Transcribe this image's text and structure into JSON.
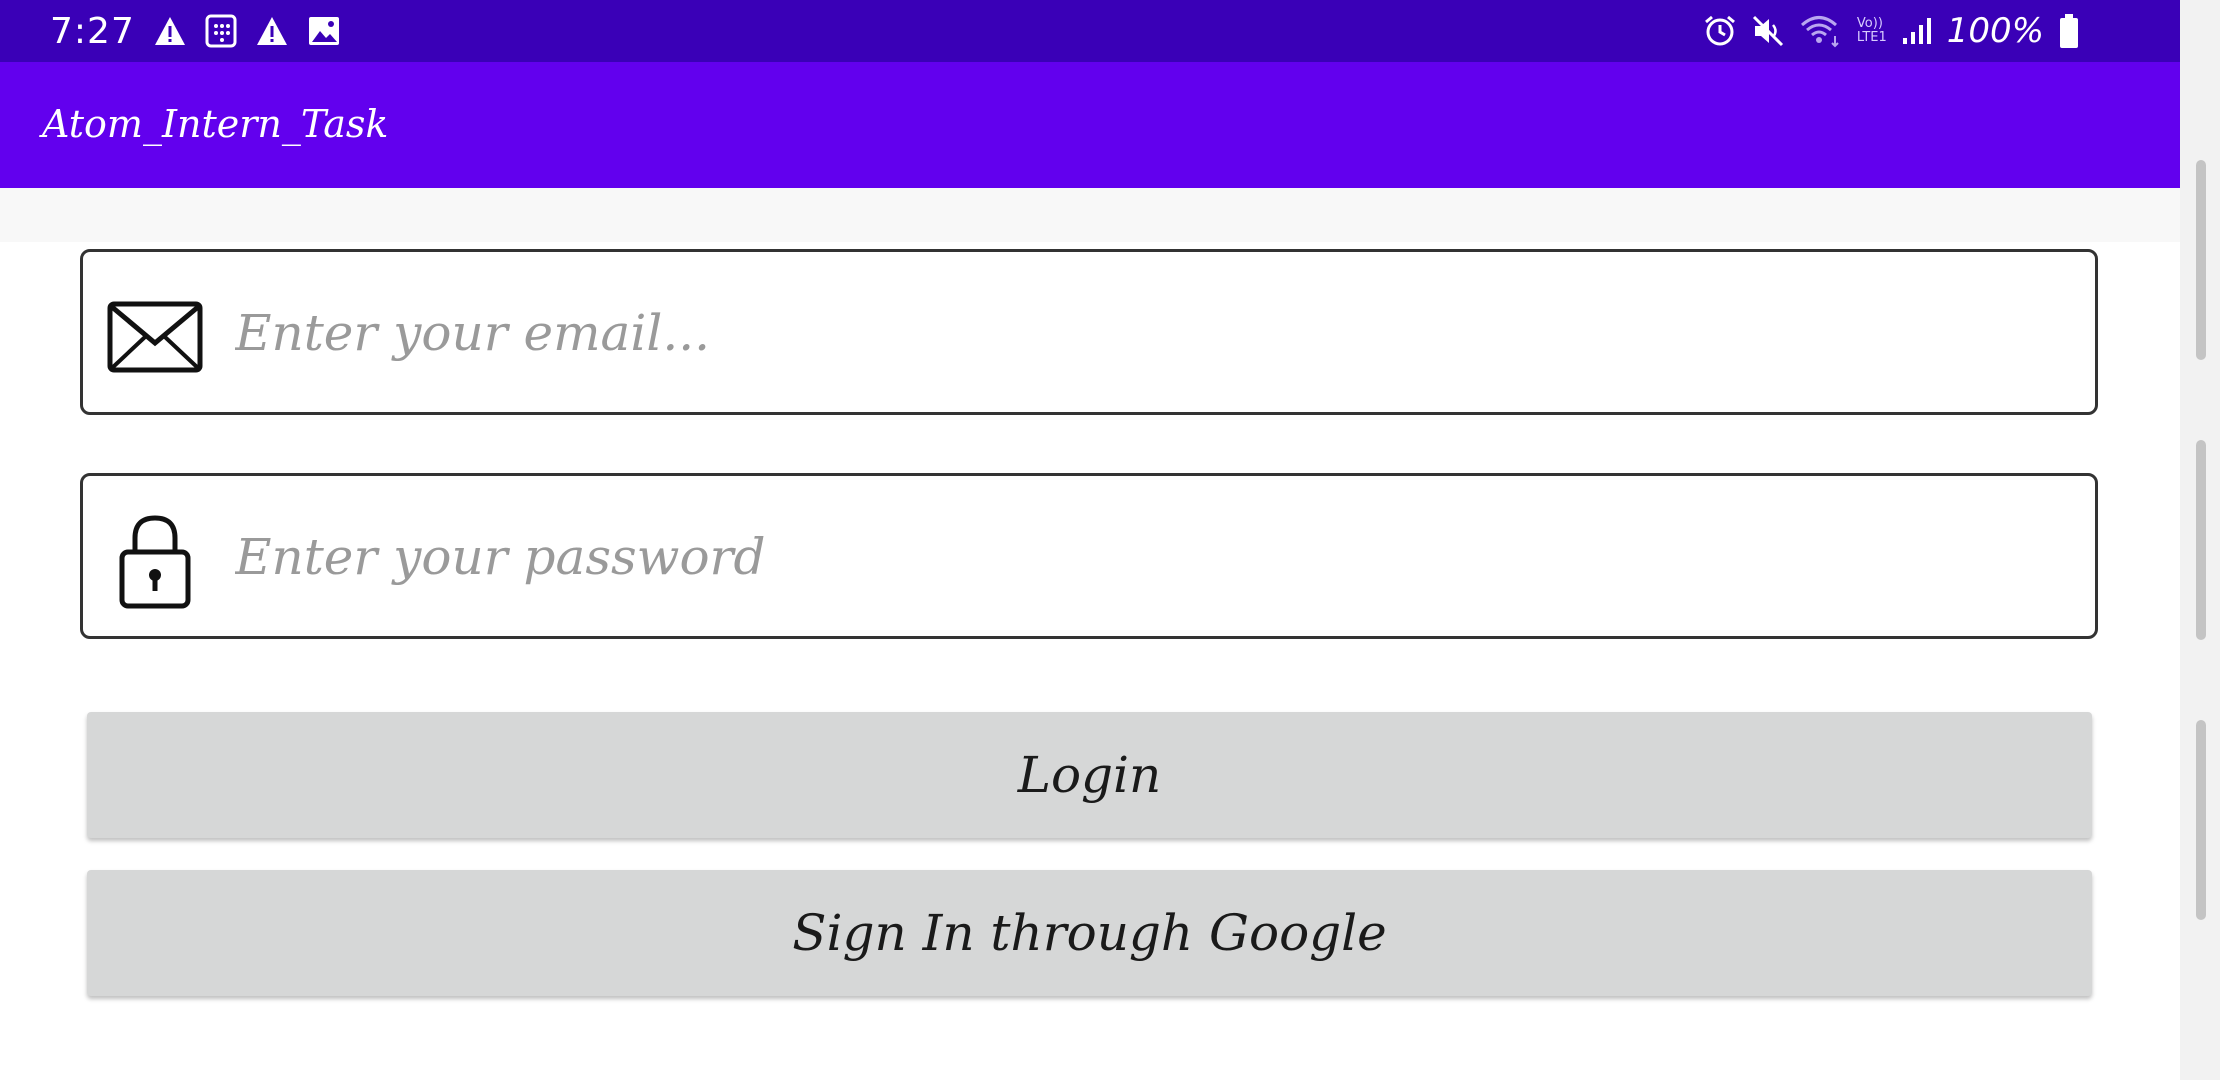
{
  "status_bar": {
    "time": "7:27",
    "battery": "100%",
    "left_icons": [
      "warning-icon",
      "calendar-icon",
      "warning-icon",
      "image-icon"
    ],
    "right_icons": [
      "alarm-icon",
      "mute-icon",
      "wifi-icon",
      "volte-icon",
      "signal-icon",
      "battery-icon"
    ],
    "volte_label": "Vo))\nLTE1"
  },
  "app_bar": {
    "title": "Atom_Intern_Task"
  },
  "form": {
    "email": {
      "placeholder": "Enter your email...",
      "value": "",
      "icon": "mail-icon"
    },
    "password": {
      "placeholder": "Enter your password",
      "value": "",
      "icon": "lock-icon"
    },
    "login_label": "Login",
    "google_label": "Sign In through Google"
  },
  "colors": {
    "status_bar": "#3a00b7",
    "app_bar": "#6200ee",
    "button_bg": "#d6d7d7",
    "field_border": "#333333"
  }
}
